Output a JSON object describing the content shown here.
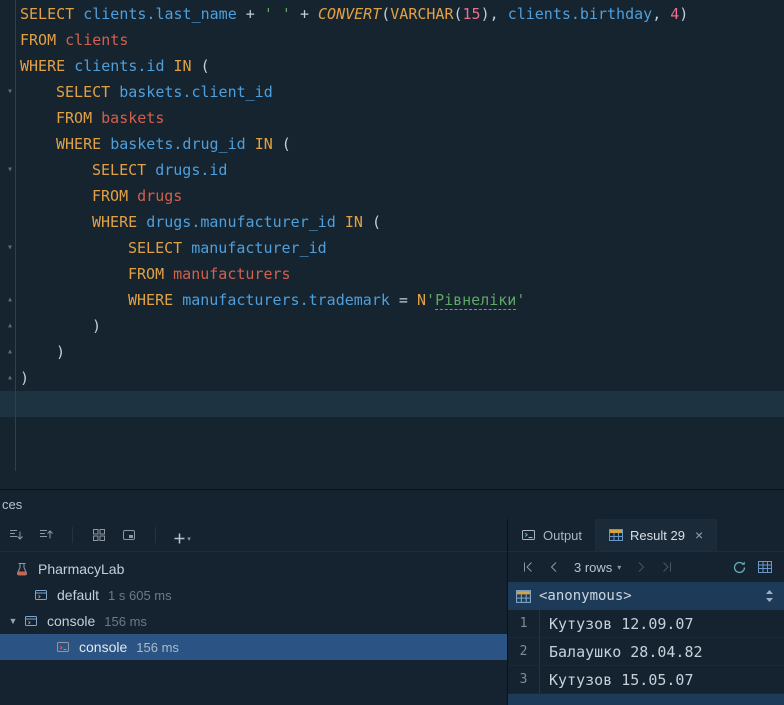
{
  "colors": {
    "editor_bg": "#16242f",
    "panel_bg": "#152230",
    "caret_line": "#1e3342",
    "gutter_line": "#2b4252",
    "fold_icon": "#5f6d79",
    "kw": "#e2a144",
    "id": "#4e9fdd",
    "tbl": "#d2604e",
    "str": "#5ea765",
    "num": "#e8708e",
    "pl": "#c2ced8",
    "dim": "#6e7a84",
    "tree_text": "#c4cfd8",
    "tab_text": "#aab5bf",
    "selection": "#2b5484",
    "grid_header_bg": "#1d3b58",
    "grid_text": "#c6d1d9",
    "rownum_text": "#7f8c98",
    "border_soft": "#1f2d39",
    "border_dark": "#0b1118",
    "icon_stroke": "#8d98a1",
    "icon_disabled": "#4a565f",
    "refresh": "#67aebc",
    "accent_yellow": "#d8a441",
    "accent_blue": "#6a96c8"
  },
  "icons": {
    "fold_down": "▾",
    "fold_up": "▴",
    "tree_expanded": "▼",
    "close": "×",
    "dropdown": "▾"
  },
  "editor": {
    "lines": [
      {
        "indent": 0,
        "tokens": [
          [
            "SELECT",
            "kw"
          ],
          [
            " ",
            "pl"
          ],
          [
            "clients.last_name",
            "id"
          ],
          [
            " + ",
            "pl"
          ],
          [
            "' '",
            "str"
          ],
          [
            " + ",
            "pl"
          ],
          [
            "CONVERT",
            "fn"
          ],
          [
            "(",
            "pl"
          ],
          [
            "VARCHAR",
            "kw"
          ],
          [
            "(",
            "pl"
          ],
          [
            "15",
            "num"
          ],
          [
            ")",
            "pl"
          ],
          [
            ", ",
            "pl"
          ],
          [
            "clients.birthday",
            "id"
          ],
          [
            ", ",
            "pl"
          ],
          [
            "4",
            "num"
          ],
          [
            ")",
            "pl"
          ]
        ]
      },
      {
        "indent": 0,
        "tokens": [
          [
            "FROM",
            "kw"
          ],
          [
            " ",
            "pl"
          ],
          [
            "clients",
            "tbl"
          ]
        ]
      },
      {
        "indent": 0,
        "tokens": [
          [
            "WHERE",
            "kw"
          ],
          [
            " ",
            "pl"
          ],
          [
            "clients.id",
            "id"
          ],
          [
            " ",
            "pl"
          ],
          [
            "IN",
            "kw"
          ],
          [
            " (",
            "pl"
          ]
        ]
      },
      {
        "indent": 1,
        "fold": "down",
        "tokens": [
          [
            "SELECT",
            "kw"
          ],
          [
            " ",
            "pl"
          ],
          [
            "baskets.client_id",
            "id"
          ]
        ]
      },
      {
        "indent": 1,
        "tokens": [
          [
            "FROM",
            "kw"
          ],
          [
            " ",
            "pl"
          ],
          [
            "baskets",
            "tbl"
          ]
        ]
      },
      {
        "indent": 1,
        "tokens": [
          [
            "WHERE",
            "kw"
          ],
          [
            " ",
            "pl"
          ],
          [
            "baskets.drug_id",
            "id"
          ],
          [
            " ",
            "pl"
          ],
          [
            "IN",
            "kw"
          ],
          [
            " (",
            "pl"
          ]
        ]
      },
      {
        "indent": 2,
        "fold": "down",
        "tokens": [
          [
            "SELECT",
            "kw"
          ],
          [
            " ",
            "pl"
          ],
          [
            "drugs.id",
            "id"
          ]
        ]
      },
      {
        "indent": 2,
        "tokens": [
          [
            "FROM",
            "kw"
          ],
          [
            " ",
            "pl"
          ],
          [
            "drugs",
            "tbl"
          ]
        ]
      },
      {
        "indent": 2,
        "tokens": [
          [
            "WHERE",
            "kw"
          ],
          [
            " ",
            "pl"
          ],
          [
            "drugs.manufacturer_id",
            "id"
          ],
          [
            " ",
            "pl"
          ],
          [
            "IN",
            "kw"
          ],
          [
            " (",
            "pl"
          ]
        ]
      },
      {
        "indent": 3,
        "fold": "down",
        "tokens": [
          [
            "SELECT",
            "kw"
          ],
          [
            " ",
            "pl"
          ],
          [
            "manufacturer_id",
            "id"
          ]
        ]
      },
      {
        "indent": 3,
        "tokens": [
          [
            "FROM",
            "kw"
          ],
          [
            " ",
            "pl"
          ],
          [
            "manufacturers",
            "tbl"
          ]
        ]
      },
      {
        "indent": 3,
        "fold": "up",
        "tokens": [
          [
            "WHERE",
            "kw"
          ],
          [
            " ",
            "pl"
          ],
          [
            "manufacturers.trademark",
            "id"
          ],
          [
            " = ",
            "pl"
          ],
          [
            "N",
            "kw"
          ],
          [
            "'",
            "str"
          ],
          [
            "Рівнеліки",
            "typo"
          ],
          [
            "'",
            "str"
          ]
        ]
      },
      {
        "indent": 2,
        "fold": "up",
        "tokens": [
          [
            ")",
            "pl"
          ]
        ]
      },
      {
        "indent": 1,
        "fold": "up",
        "tokens": [
          [
            ")",
            "pl"
          ]
        ]
      },
      {
        "indent": 0,
        "fold": "up",
        "tokens": [
          [
            ")",
            "pl"
          ]
        ]
      },
      {
        "indent": 0,
        "caret": true,
        "tokens": []
      }
    ]
  },
  "services": {
    "title": "ces",
    "tree": [
      {
        "label": "PharmacyLab",
        "time": "",
        "level": 1,
        "icon": "session"
      },
      {
        "label": "default",
        "time": "1 s 605 ms",
        "level": 2,
        "icon": "task"
      },
      {
        "label": "console",
        "time": "156 ms",
        "level": 2,
        "icon": "task",
        "expanded": true
      },
      {
        "label": "console",
        "time": "156 ms",
        "level": 3,
        "icon": "console",
        "selected": true
      }
    ]
  },
  "output_panel": {
    "tabs": [
      {
        "label": "Output"
      },
      {
        "label": "Result 29",
        "active": true
      }
    ],
    "pager": {
      "rows_label": "3 rows"
    },
    "grid": {
      "header": "<anonymous>",
      "rows": [
        {
          "n": "1",
          "value": "Кутузов 12.09.07"
        },
        {
          "n": "2",
          "value": "Балаушко 28.04.82"
        },
        {
          "n": "3",
          "value": "Кутузов 15.05.07"
        }
      ]
    }
  }
}
